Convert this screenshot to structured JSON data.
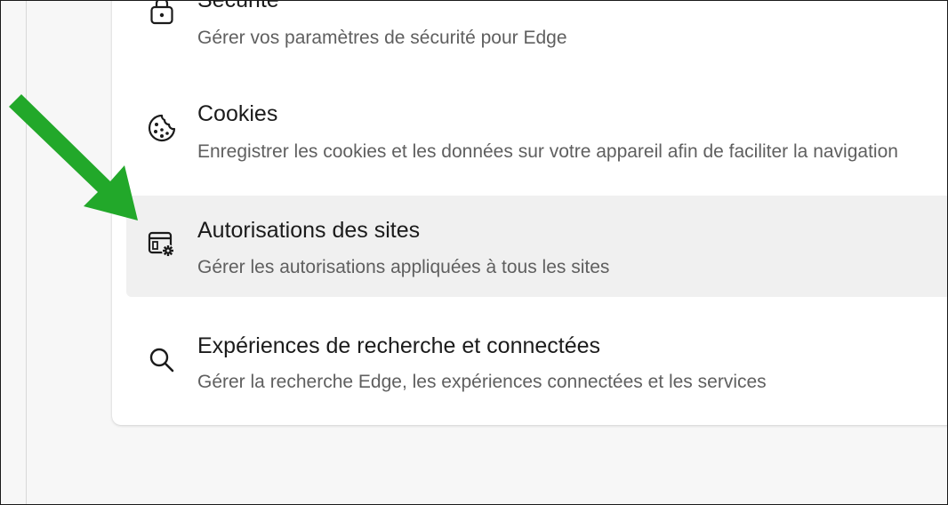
{
  "settings_list": {
    "items": [
      {
        "id": "security",
        "icon": "lock-icon",
        "title": "Sécurité",
        "description": "Gérer vos paramètres de sécurité pour Edge"
      },
      {
        "id": "cookies",
        "icon": "cookie-icon",
        "title": "Cookies",
        "description": "Enregistrer les cookies et les données sur votre appareil afin de faciliter la navigation"
      },
      {
        "id": "site-permissions",
        "icon": "site-settings-icon",
        "title": "Autorisations des sites",
        "description": "Gérer les autorisations appliquées à tous les sites",
        "highlighted": true
      },
      {
        "id": "search",
        "icon": "search-icon",
        "title": "Expériences de recherche et connectées",
        "description": "Gérer la recherche Edge, les expériences connectées et les services"
      }
    ]
  },
  "annotation": {
    "arrow_color": "#22a82a",
    "icon": "green-arrow-icon"
  },
  "colors": {
    "highlight_bg": "#f0f0f0",
    "title_text": "#1b1b1b",
    "description_text": "#5f5f5f"
  }
}
